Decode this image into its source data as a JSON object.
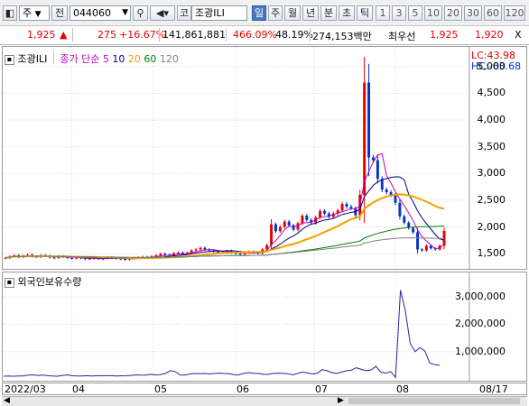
{
  "toolbar": {
    "code": "044060",
    "market": "코",
    "stock_name": "조광ILI",
    "market_select": "주",
    "prev_label": "전",
    "periods": [
      "일",
      "주",
      "월",
      "년",
      "분",
      "초",
      "틱"
    ],
    "active_period": "일",
    "intervals": [
      "1",
      "3",
      "5",
      "10",
      "20",
      "30",
      "60",
      "120"
    ]
  },
  "infobar": {
    "price": "1,925",
    "change": "275",
    "change_pct": "+16.67%",
    "volume": "141,861,881",
    "volume_ratio": "466.09%",
    "rate": "48.19%",
    "amount": "274,153백만",
    "best_label": "최우선",
    "ask": "1,925",
    "bid": "1,920",
    "close_icon": "X"
  },
  "price_panel": {
    "tab_label": "조광ILI",
    "ma_label": "종가 단순",
    "ma_periods": [
      "5",
      "10",
      "20",
      "60",
      "120"
    ],
    "ma_colors": [
      "#c000c0",
      "#000080",
      "#f0a000",
      "#008000",
      "#808080"
    ],
    "lc": "LC:43.98",
    "hc": "HC:-63.68",
    "y_ticks": [
      "5,000",
      "4,500",
      "4,000",
      "3,500",
      "3,000",
      "2,500",
      "2,000",
      "1,500"
    ]
  },
  "volume_panel": {
    "title": "외국인보유수량",
    "y_ticks": [
      "3,000,000",
      "2,000,000",
      "1,000,000"
    ]
  },
  "x_axis": {
    "labels": [
      "2022/03",
      "04",
      "05",
      "06",
      "07",
      "08"
    ],
    "end_label": "08/17"
  },
  "chart_data": [
    {
      "type": "candlestick",
      "title": "조광ILI",
      "ylim": [
        1250,
        5300
      ],
      "y_ticks": [
        5000,
        4500,
        4000,
        3500,
        3000,
        2500,
        2000,
        1500
      ],
      "moving_averages": [
        "5",
        "10",
        "20",
        "60",
        "120"
      ],
      "close": [
        1420,
        1450,
        1470,
        1440,
        1460,
        1480,
        1450,
        1440,
        1470,
        1460,
        1430,
        1420,
        1450,
        1440,
        1420,
        1410,
        1430,
        1420,
        1400,
        1410,
        1420,
        1400,
        1410,
        1430,
        1420,
        1410,
        1400,
        1390,
        1410,
        1420,
        1430,
        1440,
        1430,
        1450,
        1470,
        1500,
        1480,
        1460,
        1510,
        1520,
        1500,
        1520,
        1560,
        1580,
        1610,
        1580,
        1560,
        1540,
        1520,
        1530,
        1550,
        1520,
        1500,
        1490,
        1520,
        1540,
        1520,
        1510,
        1580,
        1660,
        2050,
        1920,
        2000,
        2100,
        2030,
        1950,
        2070,
        2210,
        2130,
        2080,
        2180,
        2300,
        2250,
        2190,
        2250,
        2310,
        2430,
        2380,
        2350,
        2220,
        2600,
        4700,
        3300,
        3250,
        2900,
        2700,
        2650,
        2600,
        2450,
        2200,
        2080,
        1980,
        1900,
        1580,
        1560,
        1650,
        1600,
        1580,
        1650,
        1925
      ]
    },
    {
      "type": "line",
      "title": "외국인보유수량",
      "ylim": [
        0,
        3500000
      ],
      "y_ticks": [
        3000000,
        2000000,
        1000000
      ],
      "values": [
        100000,
        110000,
        100000,
        105000,
        110000,
        140000,
        150000,
        130000,
        140000,
        120000,
        110000,
        100000,
        130000,
        150000,
        120000,
        110000,
        110000,
        120000,
        110000,
        115000,
        120000,
        120000,
        115000,
        110000,
        115000,
        120000,
        130000,
        150000,
        140000,
        140000,
        170000,
        150000,
        160000,
        200000,
        300000,
        270000,
        150000,
        140000,
        180000,
        200000,
        190000,
        200000,
        180000,
        200000,
        210000,
        200000,
        190000,
        160000,
        150000,
        200000,
        230000,
        210000,
        200000,
        170000,
        170000,
        200000,
        210000,
        200000,
        190000,
        150000,
        200000,
        250000,
        220000,
        180000,
        200000,
        340000,
        300000,
        230000,
        200000,
        250000,
        300000,
        320000,
        410000,
        350000,
        300000,
        330000,
        460000,
        250000,
        210000,
        270000,
        60000,
        3250000,
        2500000,
        1300000,
        1000000,
        1150000,
        1020000,
        580000,
        520000,
        500000
      ]
    }
  ]
}
